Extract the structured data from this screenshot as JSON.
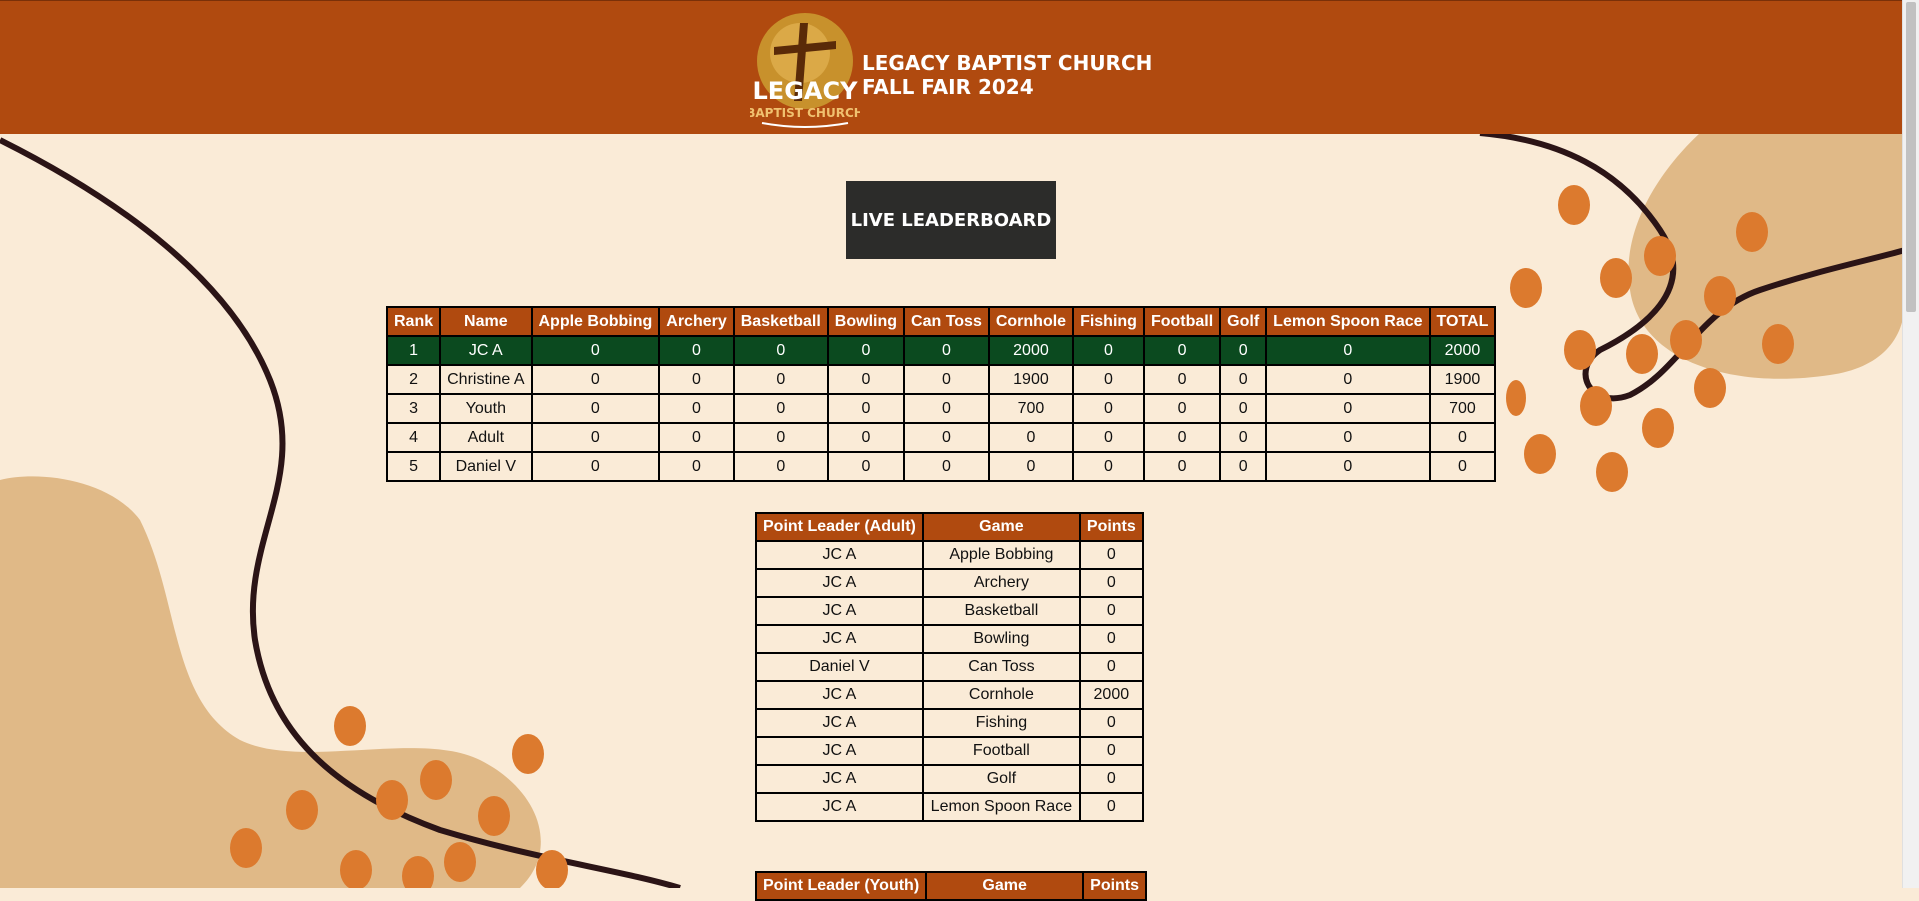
{
  "header": {
    "logo_text_1": "LEGACY",
    "logo_text_2": "BAPTIST CHURCH",
    "title_line1": "LEGACY BAPTIST CHURCH",
    "title_line2": "FALL FAIR 2024"
  },
  "banner": {
    "label": "LIVE LEADERBOARD"
  },
  "leaderboard": {
    "headers": [
      "Rank",
      "Name",
      "Apple Bobbing",
      "Archery",
      "Basketball",
      "Bowling",
      "Can Toss",
      "Cornhole",
      "Fishing",
      "Football",
      "Golf",
      "Lemon Spoon Race",
      "TOTAL"
    ],
    "rows": [
      [
        "1",
        "JC A",
        "0",
        "0",
        "0",
        "0",
        "0",
        "2000",
        "0",
        "0",
        "0",
        "0",
        "2000"
      ],
      [
        "2",
        "Christine A",
        "0",
        "0",
        "0",
        "0",
        "0",
        "1900",
        "0",
        "0",
        "0",
        "0",
        "1900"
      ],
      [
        "3",
        "Youth",
        "0",
        "0",
        "0",
        "0",
        "0",
        "700",
        "0",
        "0",
        "0",
        "0",
        "700"
      ],
      [
        "4",
        "Adult",
        "0",
        "0",
        "0",
        "0",
        "0",
        "0",
        "0",
        "0",
        "0",
        "0",
        "0"
      ],
      [
        "5",
        "Daniel V",
        "0",
        "0",
        "0",
        "0",
        "0",
        "0",
        "0",
        "0",
        "0",
        "0",
        "0"
      ]
    ]
  },
  "adult_leaders": {
    "headers": [
      "Point Leader (Adult)",
      "Game",
      "Points"
    ],
    "rows": [
      [
        "JC A",
        "Apple Bobbing",
        "0"
      ],
      [
        "JC A",
        "Archery",
        "0"
      ],
      [
        "JC A",
        "Basketball",
        "0"
      ],
      [
        "JC A",
        "Bowling",
        "0"
      ],
      [
        "Daniel V",
        "Can Toss",
        "0"
      ],
      [
        "JC A",
        "Cornhole",
        "2000"
      ],
      [
        "JC A",
        "Fishing",
        "0"
      ],
      [
        "JC A",
        "Football",
        "0"
      ],
      [
        "JC A",
        "Golf",
        "0"
      ],
      [
        "JC A",
        "Lemon Spoon Race",
        "0"
      ]
    ]
  },
  "youth_leaders": {
    "headers": [
      "Point Leader (Youth)",
      "Game",
      "Points"
    ]
  },
  "colors": {
    "header_bg": "#b04a0f",
    "page_bg": "#faebd7",
    "first_place_row": "#0b4a1f",
    "banner_bg": "#2c2c2a"
  }
}
